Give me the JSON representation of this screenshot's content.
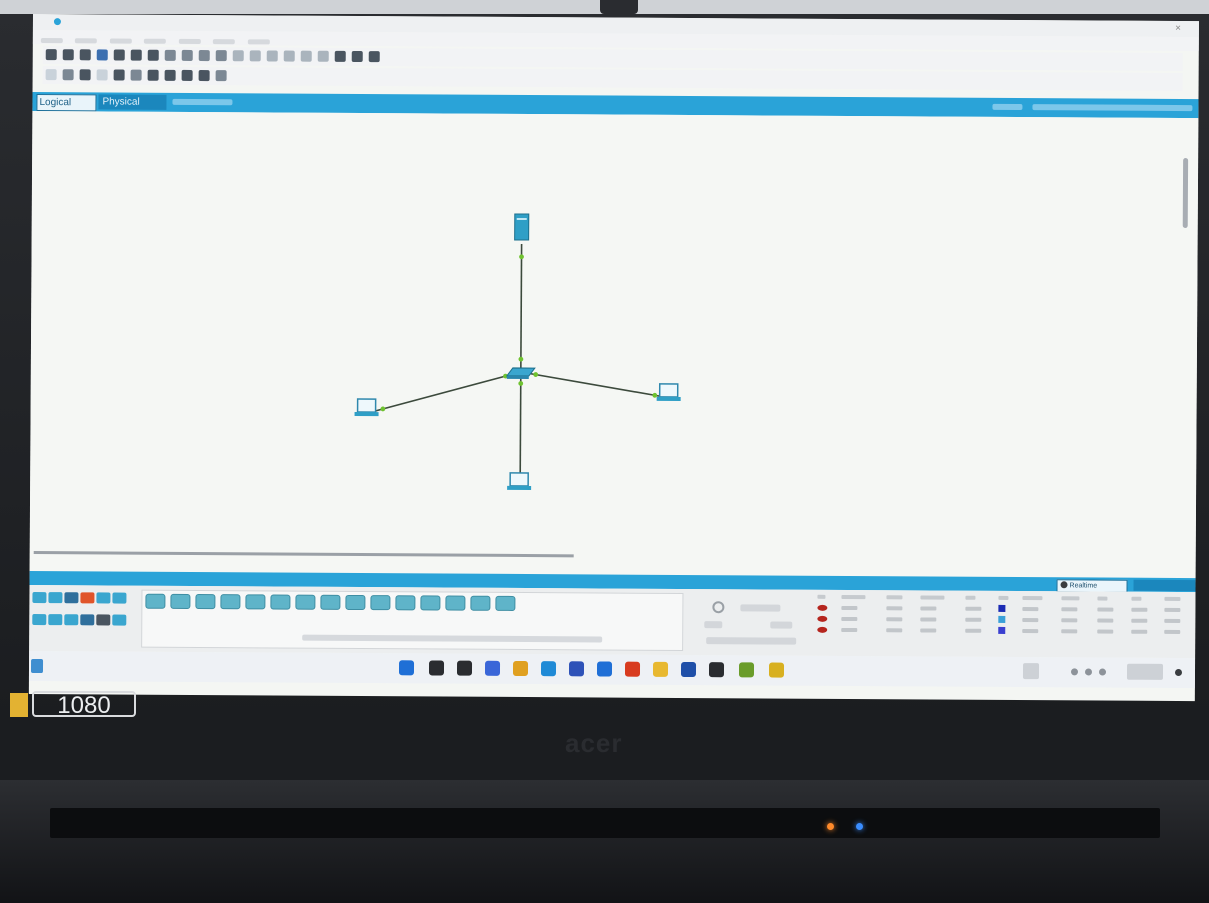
{
  "app": {
    "tabs": {
      "logical": "Logical",
      "physical": "Physical"
    }
  },
  "icons": {
    "title": "app-logo-icon",
    "workspace_tab": "logical-workspace-icon",
    "realtime": "realtime-clock-icon",
    "fire": "fire-pdu-icon"
  },
  "topology": {
    "devices": [
      {
        "id": "server",
        "kind": "server",
        "label_model": "",
        "label_name": ""
      },
      {
        "id": "switch",
        "kind": "switch",
        "label_model": "",
        "label_name": ""
      },
      {
        "id": "pc-left",
        "kind": "pc",
        "label_model": "",
        "label_name": ""
      },
      {
        "id": "pc-right",
        "kind": "pc",
        "label_model": "",
        "label_name": ""
      },
      {
        "id": "pc-bottom",
        "kind": "pc",
        "label_model": "",
        "label_name": ""
      }
    ],
    "links": [
      [
        "server",
        "switch"
      ],
      [
        "switch",
        "pc-left"
      ],
      [
        "switch",
        "pc-right"
      ],
      [
        "switch",
        "pc-bottom"
      ]
    ],
    "link_end_color": "#6fc22f",
    "link_color": "#3c4a3c"
  },
  "bottom": {
    "mode_tab": "Realtime"
  },
  "pdu_list": {
    "rows": [
      {
        "color": "#1b2bb4"
      },
      {
        "color": "#3aa0d8"
      },
      {
        "color": "#3a3fd0"
      }
    ]
  },
  "laptop": {
    "resolution_badge": "1080",
    "brand": "acer"
  },
  "colors": {
    "accent_blue": "#2aa3d8",
    "workspace_bg": "#f5f7f4",
    "fire_red": "#b5251e"
  }
}
